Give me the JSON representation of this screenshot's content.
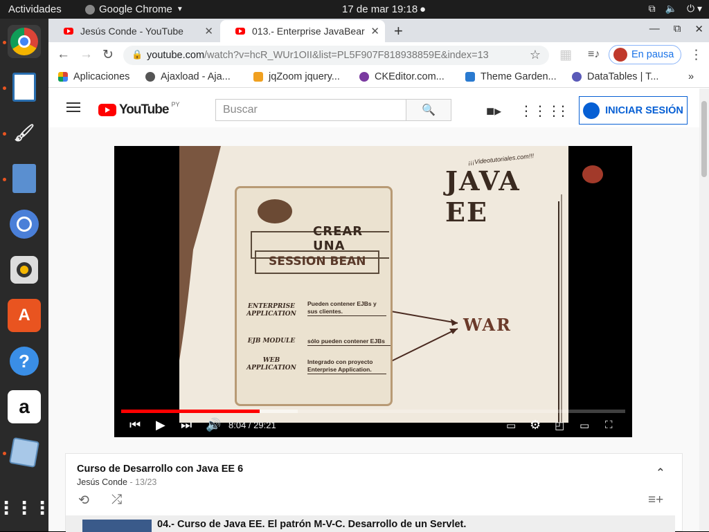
{
  "os": {
    "activities": "Actividades",
    "app_name": "Google Chrome",
    "clock": "17 de mar  19:18"
  },
  "tabs": [
    {
      "title": "Jesús Conde - YouTube"
    },
    {
      "title": "013.- Enterprise JavaBear"
    }
  ],
  "address": {
    "host": "youtube.com",
    "path": "/watch?v=hcR_WUr1OII&list=PL5F907F818938859E&index=13"
  },
  "profile": {
    "label": "En pausa"
  },
  "bookmarks": [
    {
      "label": "Aplicaciones"
    },
    {
      "label": "Ajaxload - Aja..."
    },
    {
      "label": "jqZoom jquery..."
    },
    {
      "label": "CKEditor.com..."
    },
    {
      "label": "Theme Garden..."
    },
    {
      "label": "DataTables | T..."
    }
  ],
  "bookmarks_more": "»",
  "youtube": {
    "logo_word": "YouTube",
    "country": "PY",
    "search_placeholder": "Buscar",
    "signin_label": "INICIAR SESIÓN"
  },
  "video": {
    "watermark": "¡¡¡Videotutoriales.com!!!",
    "logo_text": "JAVA EE",
    "title_line1": "CREAR UNA",
    "title_line2": "SESSION BEAN",
    "rows": [
      {
        "label": "ENTERPRISE APPLICATION",
        "desc": "Pueden contener EJBs y sus clientes."
      },
      {
        "label": "EJB MODULE",
        "desc": "sólo pueden contener EJBs"
      },
      {
        "label": "WEB APPLICATION",
        "desc": "Integrado con proyecto Enterprise Application."
      }
    ],
    "war_label": "WAR",
    "played_fraction": 0.275,
    "buffered_fraction": 0.35,
    "time_current": "8:04",
    "time_total": "29:21",
    "time_display": "8:04 / 29:21"
  },
  "playlist": {
    "title": "Curso de Desarrollo con Java EE 6",
    "channel": "Jesús Conde",
    "position": "13/23",
    "current_item": "04.- Curso de Java EE. El patrón M-V-C. Desarrollo de un Servlet."
  }
}
